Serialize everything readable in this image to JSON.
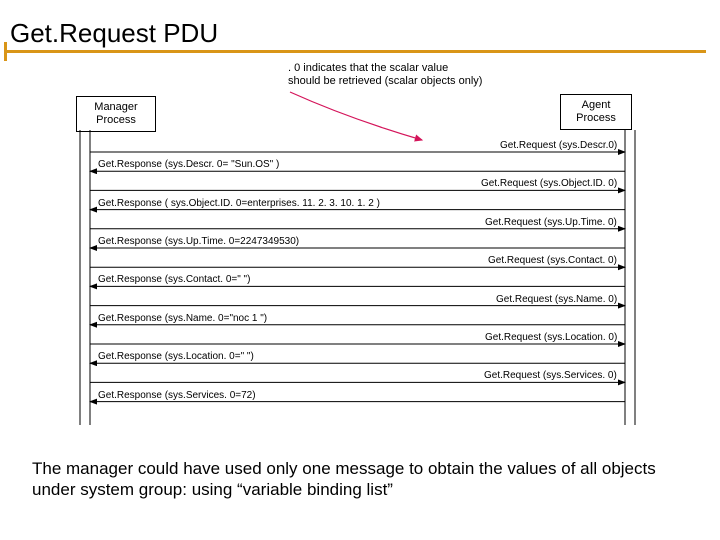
{
  "title": "Get.Request PDU",
  "annotation_line1": ". 0 indicates that the scalar value",
  "annotation_line2": "should be retrieved (scalar objects only)",
  "manager_label_l1": "Manager",
  "manager_label_l2": "Process",
  "agent_label_l1": "Agent",
  "agent_label_l2": "Process",
  "messages": [
    {
      "dir": "r",
      "text": "Get.Request (sys.Descr.0)"
    },
    {
      "dir": "l",
      "text": "Get.Response (sys.Descr. 0= \"Sun.OS\" )"
    },
    {
      "dir": "r",
      "text": "Get.Request (sys.Object.ID. 0)"
    },
    {
      "dir": "l",
      "text": "Get.Response ( sys.Object.ID. 0=enterprises. 11. 2. 3. 10. 1. 2 )"
    },
    {
      "dir": "r",
      "text": "Get.Request (sys.Up.Time. 0)"
    },
    {
      "dir": "l",
      "text": "Get.Response (sys.Up.Time. 0=2247349530)"
    },
    {
      "dir": "r",
      "text": "Get.Request (sys.Contact. 0)"
    },
    {
      "dir": "l",
      "text": "Get.Response (sys.Contact. 0=\" \")"
    },
    {
      "dir": "r",
      "text": "Get.Request (sys.Name. 0)"
    },
    {
      "dir": "l",
      "text": "Get.Response (sys.Name. 0=\"noc 1 \")"
    },
    {
      "dir": "r",
      "text": "Get.Request (sys.Location. 0)"
    },
    {
      "dir": "l",
      "text": "Get.Response (sys.Location. 0=\" \")"
    },
    {
      "dir": "r",
      "text": "Get.Request (sys.Services. 0)"
    },
    {
      "dir": "l",
      "text": "Get.Response (sys.Services. 0=72)"
    }
  ],
  "footer": "The manager could have used only one message to obtain the values of all objects under system group: using “variable binding list”"
}
